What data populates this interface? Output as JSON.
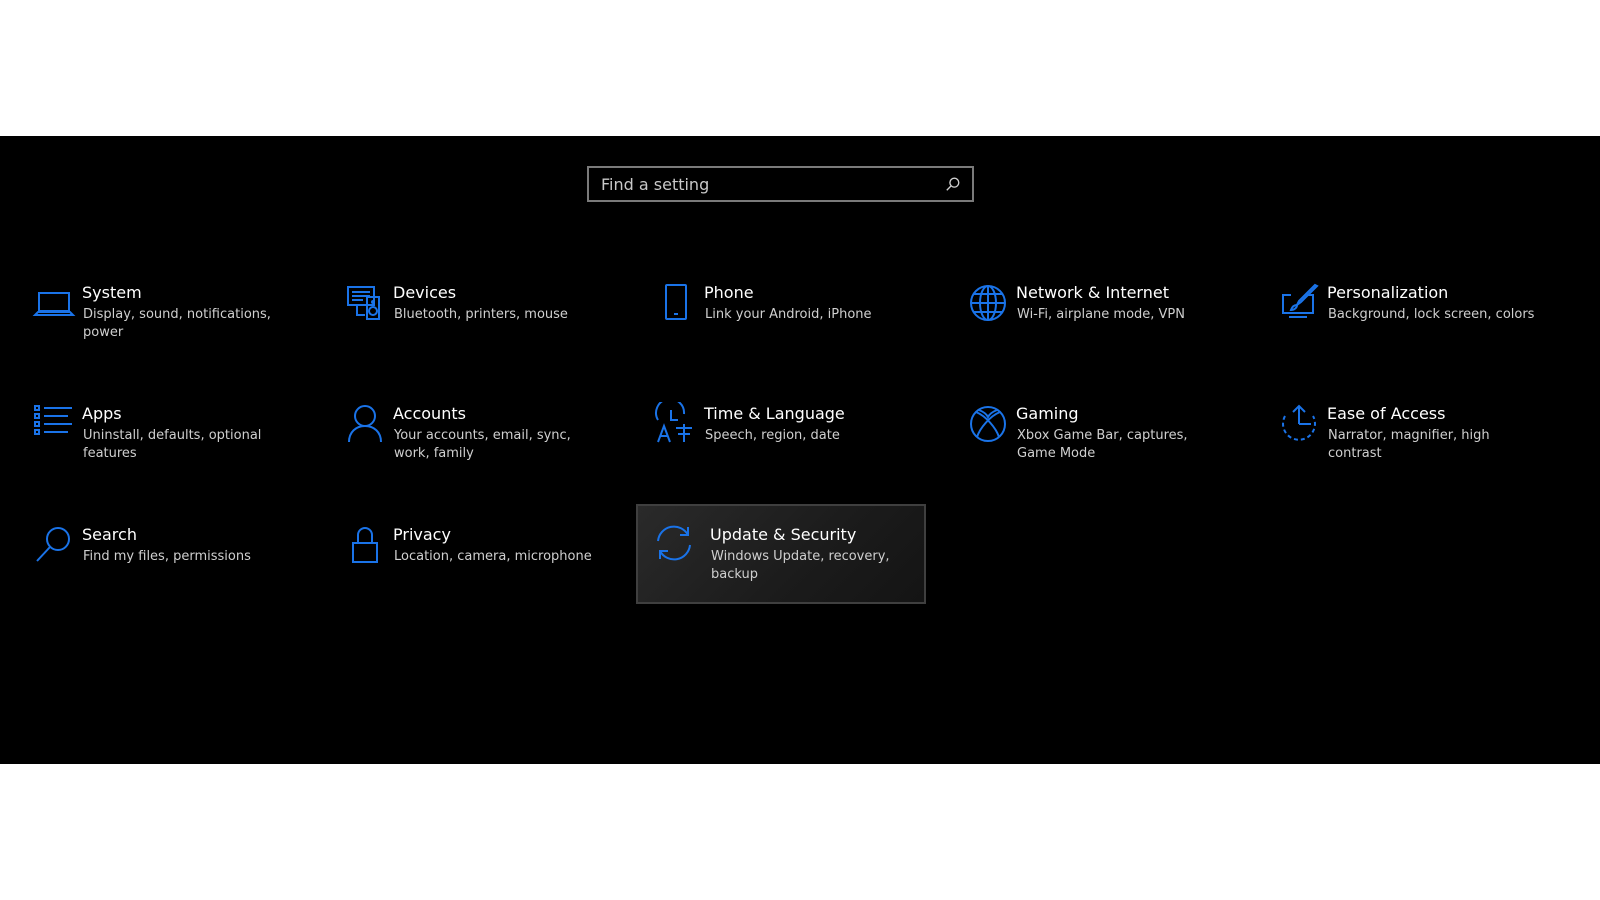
{
  "search": {
    "placeholder": "Find a setting"
  },
  "accent_color": "#1a73e8",
  "tiles": [
    {
      "title": "System",
      "desc": "Display, sound, notifications, power",
      "icon": "laptop-icon"
    },
    {
      "title": "Devices",
      "desc": "Bluetooth, printers, mouse",
      "icon": "devices-icon"
    },
    {
      "title": "Phone",
      "desc": "Link your Android, iPhone",
      "icon": "phone-icon"
    },
    {
      "title": "Network & Internet",
      "desc": "Wi-Fi, airplane mode, VPN",
      "icon": "globe-icon"
    },
    {
      "title": "Personalization",
      "desc": "Background, lock screen, colors",
      "icon": "paint-brush-icon"
    },
    {
      "title": "Apps",
      "desc": "Uninstall, defaults, optional features",
      "icon": "apps-list-icon"
    },
    {
      "title": "Accounts",
      "desc": "Your accounts, email, sync, work, family",
      "icon": "person-icon"
    },
    {
      "title": "Time & Language",
      "desc": "Speech, region, date",
      "icon": "time-language-icon"
    },
    {
      "title": "Gaming",
      "desc": "Xbox Game Bar, captures, Game Mode",
      "icon": "xbox-icon"
    },
    {
      "title": "Ease of Access",
      "desc": "Narrator, magnifier, high contrast",
      "icon": "ease-of-access-icon"
    },
    {
      "title": "Search",
      "desc": "Find my files, permissions",
      "icon": "magnifier-icon"
    },
    {
      "title": "Privacy",
      "desc": "Location, camera, microphone",
      "icon": "lock-icon"
    },
    {
      "title": "Update & Security",
      "desc": "Windows Update, recovery, backup",
      "icon": "sync-arrows-icon",
      "selected": true
    }
  ]
}
